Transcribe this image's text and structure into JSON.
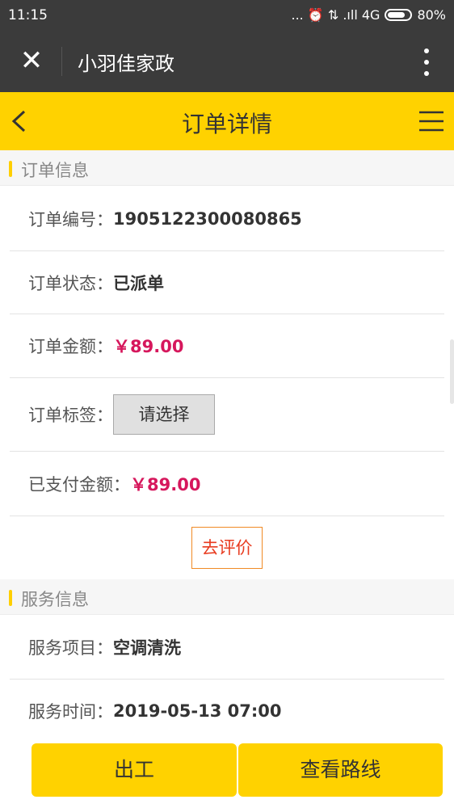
{
  "status_bar": {
    "time": "11:15",
    "signal_icons": "... ⏰ ⇅ .ıll 4G",
    "battery": "80%",
    "battery_level": 0.8
  },
  "wx_bar": {
    "close_icon": "close-icon",
    "title": "小羽佳家政",
    "more_icon": "more-vertical-icon"
  },
  "nav": {
    "title": "订单详情",
    "back_icon": "chevron-left-icon",
    "menu_icon": "hamburger-menu-icon"
  },
  "order_section": {
    "title": "订单信息",
    "order_no_label": "订单编号：",
    "order_no": "1905122300080865",
    "status_label": "订单状态：",
    "status": "已派单",
    "amount_label": "订单金额：",
    "amount": "￥89.00",
    "tag_label": "订单标签：",
    "tag_select": "请选择",
    "paid_label": "已支付金额：",
    "paid": "￥89.00",
    "review_button": "去评价"
  },
  "service_section": {
    "title": "服务信息",
    "item_label": "服务项目：",
    "item": "空调清洗",
    "time_label": "服务时间：",
    "time": "2019-05-13 07:00"
  },
  "bottom": {
    "start_work": "出工",
    "view_route": "查看路线"
  },
  "colors": {
    "accent": "#ffd200",
    "money": "#d6175c",
    "review_border": "#f08a24",
    "dark_bar": "#3b3b3b"
  }
}
